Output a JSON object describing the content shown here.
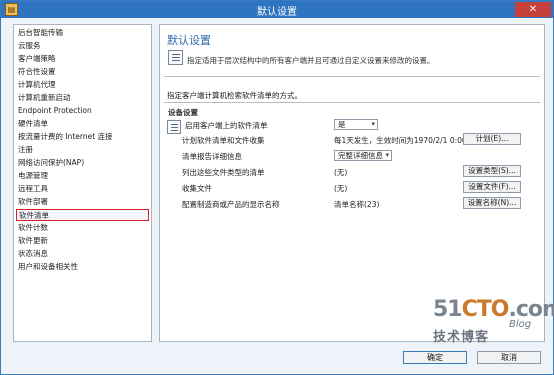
{
  "window": {
    "title": "默认设置",
    "close_label": "✕"
  },
  "sidebar": {
    "items": [
      "后台智能传输",
      "云服务",
      "客户端策略",
      "符合性设置",
      "计算机代理",
      "计算机重新启动",
      "Endpoint Protection",
      "硬件清单",
      "按流量计费的 Internet 连接",
      "注册",
      "网络访问保护(NAP)",
      "电源管理",
      "远程工具",
      "软件部署",
      "软件清单",
      "软件计数",
      "软件更新",
      "状态消息",
      "用户和设备相关性"
    ],
    "selected_index": 14
  },
  "main": {
    "title": "默认设置",
    "description": "指定适用于层次结构中的所有客户端并且可通过自定义设置来修改的设置。",
    "method_text": "指定客户端计算机检索软件清单的方式。",
    "section_title": "设备设置",
    "rows": [
      {
        "label": "启用客户端上的软件清单",
        "value": "是",
        "control": "select"
      },
      {
        "label": "计划软件清单和文件收集",
        "value": "每1天发生，生效时间为1970/2/1 0:00",
        "button": "计划(E)..."
      },
      {
        "label": "清单报告详细信息",
        "value": "完整详细信息",
        "control": "select"
      },
      {
        "label": "列出这些文件类型的清单",
        "value": "(无)",
        "button": "设置类型(S)..."
      },
      {
        "label": "收集文件",
        "value": "(无)",
        "button": "设置文件(F)..."
      },
      {
        "label": "配置制造商或产品的显示名称",
        "value": "清单名称(23)",
        "button": "设置名称(N)..."
      }
    ]
  },
  "footer": {
    "ok_label": "确定",
    "cancel_label": "取消"
  },
  "watermark": {
    "logo_a": "51",
    "logo_b": "CTO",
    "logo_c": ".com",
    "sub": "技术博客",
    "blog": "Blog"
  },
  "colors": {
    "titlebar": "#2e74c0",
    "accent_title": "#2e6bb0",
    "selection_border": "#d81e1e"
  }
}
